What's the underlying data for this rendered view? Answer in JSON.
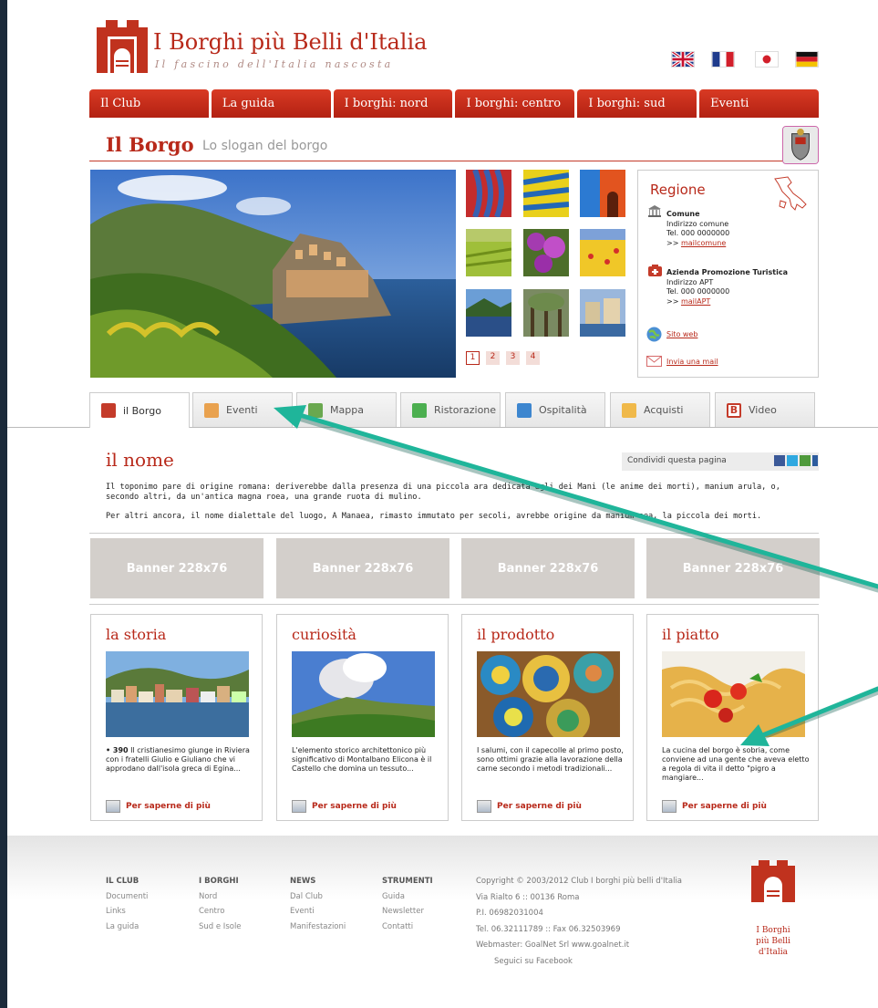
{
  "header": {
    "logo_title": "I Borghi più Belli d'Italia",
    "logo_subtitle": "Il fascino dell'Italia nascosta",
    "flags": [
      "uk-flag-icon",
      "fr-flag-icon",
      "jp-flag-icon",
      "de-flag-icon"
    ]
  },
  "nav": [
    "Il Club",
    "La guida",
    "I borghi: nord",
    "I borghi: centro",
    "I borghi: sud",
    "Eventi"
  ],
  "borgo": {
    "title": "Il Borgo",
    "slogan": "Lo slogan del borgo"
  },
  "pagination": [
    "1",
    "2",
    "3",
    "4"
  ],
  "region": {
    "title": "Regione",
    "comune_label": "Comune",
    "comune_address": "Indirizzo comune",
    "comune_tel": "Tel. 000 0000000",
    "comune_mail": "mailcomune",
    "apt_label": "Azienda Promozione Turistica",
    "apt_address": "Indirizzo APT",
    "apt_tel": "Tel. 000 0000000",
    "apt_mail": "mailAPT",
    "site_web": "Sito web",
    "send_mail": "Invia una mail",
    "mail_prefix": ">> "
  },
  "tabs": [
    "il Borgo",
    "Eventi",
    "Mappa",
    "Ristorazione",
    "Ospitalità",
    "Acquisti",
    "Video"
  ],
  "nome": {
    "title": "il nome",
    "share_label": "Condividi questa pagina",
    "paragraph1": "Il toponimo pare di origine romana: deriverebbe dalla presenza di una piccola ara dedicata agli dei Mani (le anime dei morti), manium arula, o, secondo altri, da un'antica magna roea, una grande ruota di mulino.",
    "paragraph2": "Per altri ancora, il nome dialettale del luogo, A Manaea, rimasto immutato per secoli, avrebbe origine da manium aea, la piccola dei morti."
  },
  "banners": [
    "Banner 228x76",
    "Banner 228x76",
    "Banner 228x76",
    "Banner 228x76"
  ],
  "cards": [
    {
      "title": "la storia",
      "num": "• 390",
      "text": " Il cristianesimo giunge in Riviera con i fratelli Giulio e Giuliano che vi approdano dall'isola greca di Egina...",
      "more": "Per saperne di più"
    },
    {
      "title": "curiosità",
      "num": "",
      "text": "L'elemento storico architettonico più significativo di Montalbano Elicona è il Castello che domina un tessuto...",
      "more": "Per saperne di più"
    },
    {
      "title": "il prodotto",
      "num": "",
      "text": "I salumi, con il capecolle al primo posto, sono ottimi grazie alla lavorazione della carne secondo i metodi tradizionali...",
      "more": "Per saperne di più"
    },
    {
      "title": "il piatto",
      "num": "",
      "text": "La cucina del borgo è sobria, come conviene ad una gente che aveva eletto a regola di vita il detto \"pigro a mangiare...",
      "more": "Per saperne di più"
    }
  ],
  "footer": {
    "columns": [
      {
        "heading": "IL CLUB",
        "items": [
          "Documenti",
          "Links",
          "La guida"
        ]
      },
      {
        "heading": "I BORGHI",
        "items": [
          "Nord",
          "Centro",
          "Sud e Isole"
        ]
      },
      {
        "heading": "NEWS",
        "items": [
          "Dal Club",
          "Eventi",
          "Manifestazioni"
        ]
      },
      {
        "heading": "STRUMENTI",
        "items": [
          "Guida",
          "Newsletter",
          "Contatti"
        ]
      }
    ],
    "copyright": "Copyright © 2003/2012 Club I borghi più belli d'Italia",
    "address": "Via Rialto 6 :: 00136 Roma",
    "piva": "P.I. 06982031004",
    "tel": "Tel. 06.32111789 :: Fax 06.32503969",
    "webmaster": "Webmaster: GoalNet Srl www.goalnet.it",
    "facebook": "Seguici su Facebook",
    "logo_text_1": "I Borghi",
    "logo_text_2": "più Belli",
    "logo_text_3": "d'Italia"
  },
  "colors": {
    "brand_red": "#b8291a",
    "annotation_arrow": "#1fb59a"
  }
}
